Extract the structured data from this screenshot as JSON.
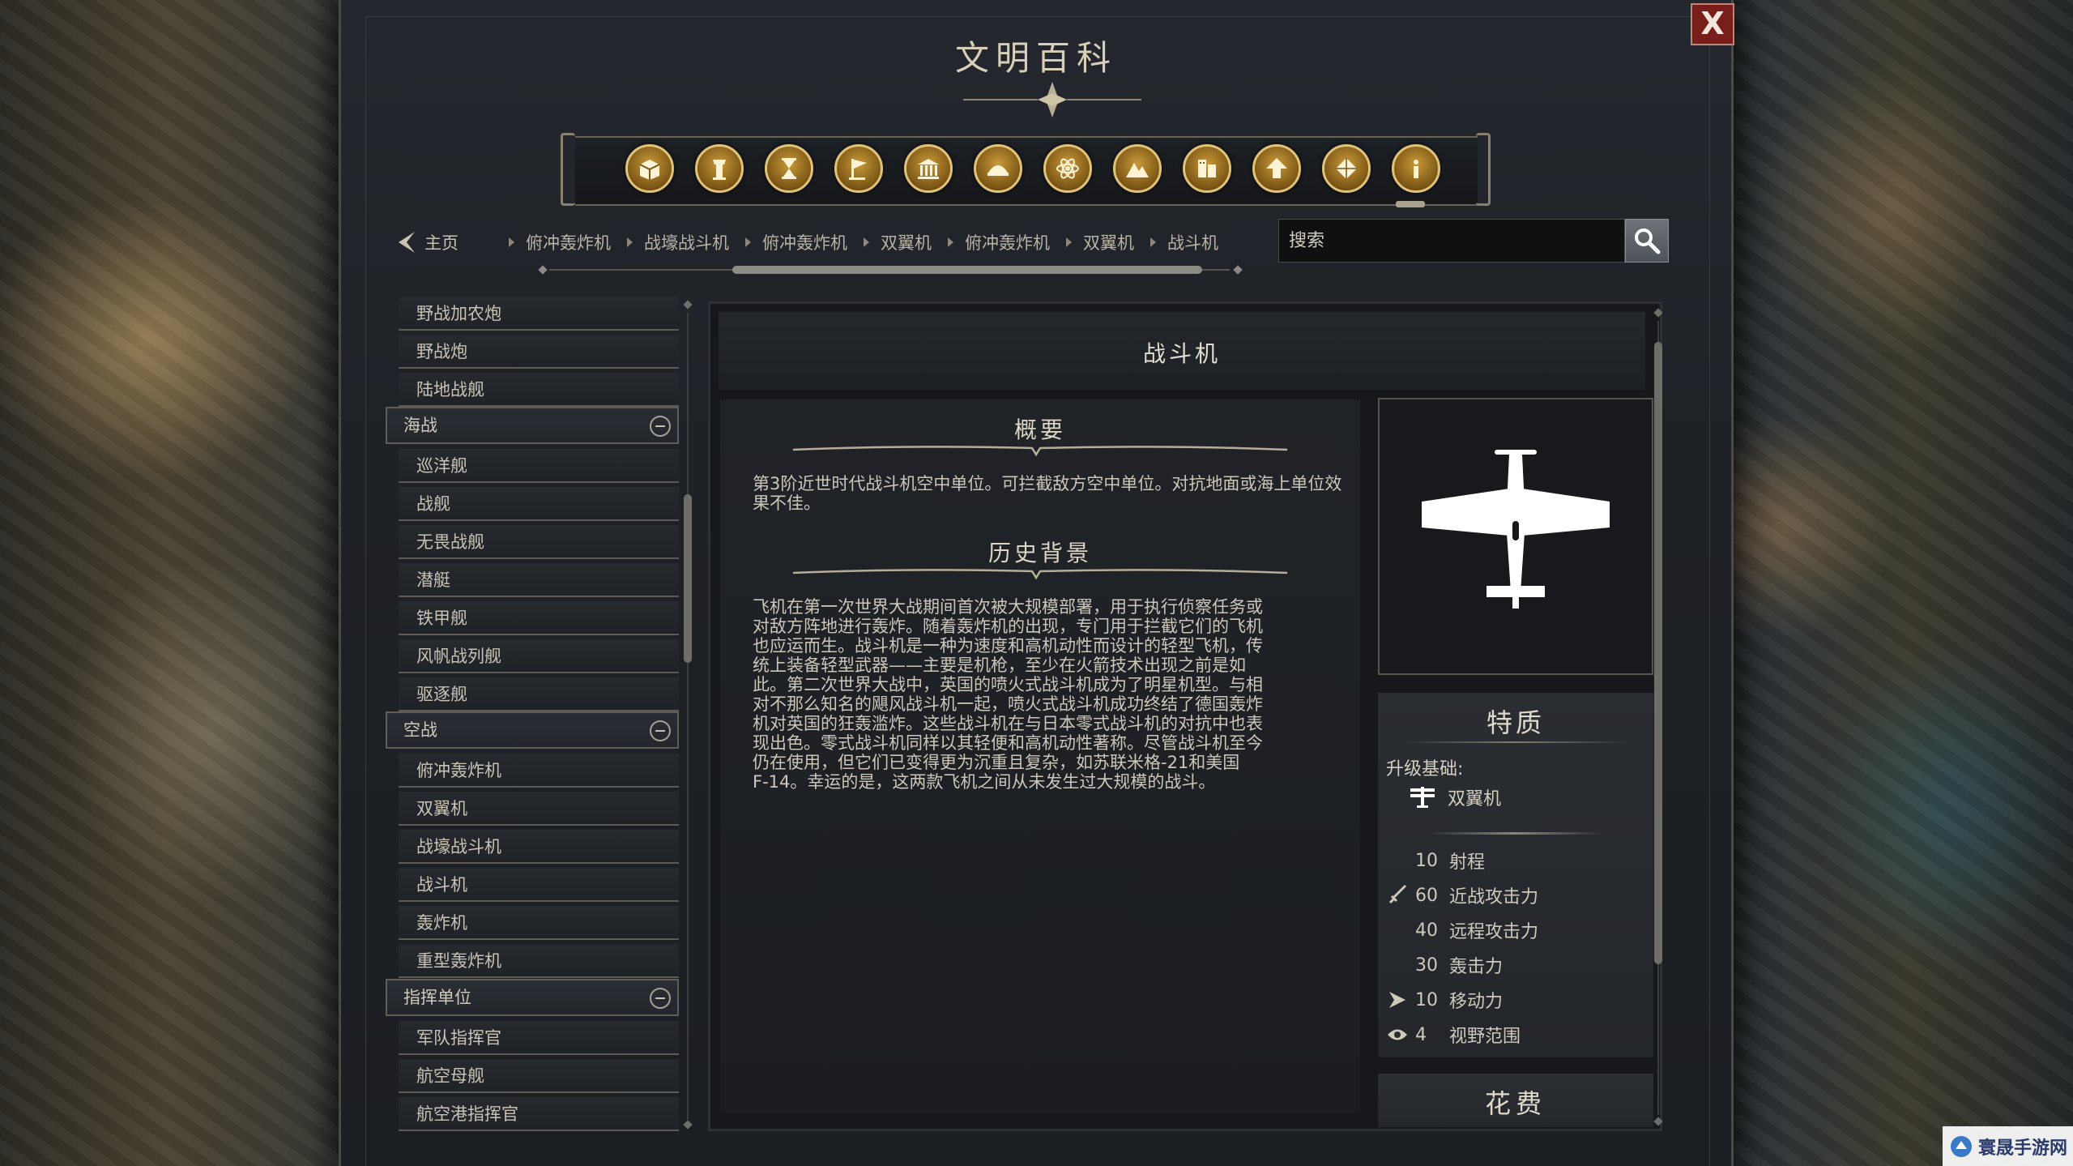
{
  "window": {
    "title": "文明百科",
    "close_label": "X"
  },
  "categories": [
    {
      "name": "resources",
      "icon": "crate-icon"
    },
    {
      "name": "buildings",
      "icon": "tower-icon"
    },
    {
      "name": "eras",
      "icon": "hourglass-icon"
    },
    {
      "name": "civilizations",
      "icon": "flag-icon"
    },
    {
      "name": "governments",
      "icon": "temple-icon"
    },
    {
      "name": "wonders",
      "icon": "dome-icon"
    },
    {
      "name": "technologies",
      "icon": "atom-icon"
    },
    {
      "name": "terrain",
      "icon": "mountain-icon"
    },
    {
      "name": "units",
      "icon": "soldier-icon"
    },
    {
      "name": "upgrades",
      "icon": "up-arrow-icon"
    },
    {
      "name": "districts",
      "icon": "diamond-icon"
    },
    {
      "name": "info",
      "icon": "info-icon"
    }
  ],
  "selected_category": "info",
  "nav": {
    "home_label": "主页",
    "breadcrumbs": [
      "俯冲轰炸机",
      "战壕战斗机",
      "俯冲轰炸机",
      "双翼机",
      "俯冲轰炸机",
      "双翼机",
      "战斗机"
    ]
  },
  "search": {
    "placeholder": "搜索",
    "value": ""
  },
  "sidebar": {
    "items": [
      {
        "type": "item",
        "label": "野战加农炮"
      },
      {
        "type": "item",
        "label": "野战炮"
      },
      {
        "type": "item",
        "label": "陆地战舰"
      },
      {
        "type": "category",
        "label": "海战"
      },
      {
        "type": "item",
        "label": "巡洋舰"
      },
      {
        "type": "item",
        "label": "战舰"
      },
      {
        "type": "item",
        "label": "无畏战舰"
      },
      {
        "type": "item",
        "label": "潜艇"
      },
      {
        "type": "item",
        "label": "铁甲舰"
      },
      {
        "type": "item",
        "label": "风帆战列舰"
      },
      {
        "type": "item",
        "label": "驱逐舰"
      },
      {
        "type": "category",
        "label": "空战"
      },
      {
        "type": "item",
        "label": "俯冲轰炸机"
      },
      {
        "type": "item",
        "label": "双翼机"
      },
      {
        "type": "item",
        "label": "战壕战斗机"
      },
      {
        "type": "item",
        "label": "战斗机"
      },
      {
        "type": "item",
        "label": "轰炸机"
      },
      {
        "type": "item",
        "label": "重型轰炸机"
      },
      {
        "type": "category",
        "label": "指挥单位"
      },
      {
        "type": "item",
        "label": "军队指挥官"
      },
      {
        "type": "item",
        "label": "航空母舰"
      },
      {
        "type": "item",
        "label": "航空港指挥官"
      }
    ]
  },
  "article": {
    "title": "战斗机",
    "overview_heading": "概要",
    "overview_text": "第3阶近世时代战斗机空中单位。可拦截敌方空中单位。对抗地面或海上单位效果不佳。",
    "history_heading": "历史背景",
    "history_lines": [
      "飞机在第一次世界大战期间首次被大规模部署，用于执行侦察任务或",
      "对敌方阵地进行轰炸。随着轰炸机的出现，专门用于拦截它们的飞机",
      "也应运而生。战斗机是一种为速度和高机动性而设计的轻型飞机，传",
      "统上装备轻型武器——主要是机枪，至少在火箭技术出现之前是如",
      "此。第二次世界大战中，英国的喷火式战斗机成为了明星机型。与相",
      "对不那么知名的飓风战斗机一起，喷火式战斗机成功终结了德国轰炸",
      "机对英国的狂轰滥炸。这些战斗机在与日本零式战斗机的对抗中也表",
      "现出色。零式战斗机同样以其轻便和高机动性著称。尽管战斗机至今",
      "仍在使用，但它们已变得更为沉重且复杂，如苏联米格-21和美国",
      "F-14。幸运的是，这两款飞机之间从未发生过大规模的战斗。"
    ]
  },
  "traits": {
    "heading": "特质",
    "upgrade_label": "升级基础:",
    "upgrade_from": "双翼机",
    "stats": [
      {
        "icon": "",
        "value": "10",
        "label": "射程"
      },
      {
        "icon": "sword-icon",
        "value": "60",
        "label": "近战攻击力"
      },
      {
        "icon": "",
        "value": "40",
        "label": "远程攻击力"
      },
      {
        "icon": "",
        "value": "30",
        "label": "轰击力"
      },
      {
        "icon": "move-arrow-icon",
        "value": "10",
        "label": "移动力"
      },
      {
        "icon": "eye-icon",
        "value": "4",
        "label": "视野范围"
      }
    ]
  },
  "cost": {
    "heading": "花费"
  },
  "watermark": {
    "name": "寰晟手游网"
  },
  "colors": {
    "accent_gold": "#c99a3a",
    "close_red": "#7a1e1c",
    "panel_bg": "#1e2126"
  }
}
